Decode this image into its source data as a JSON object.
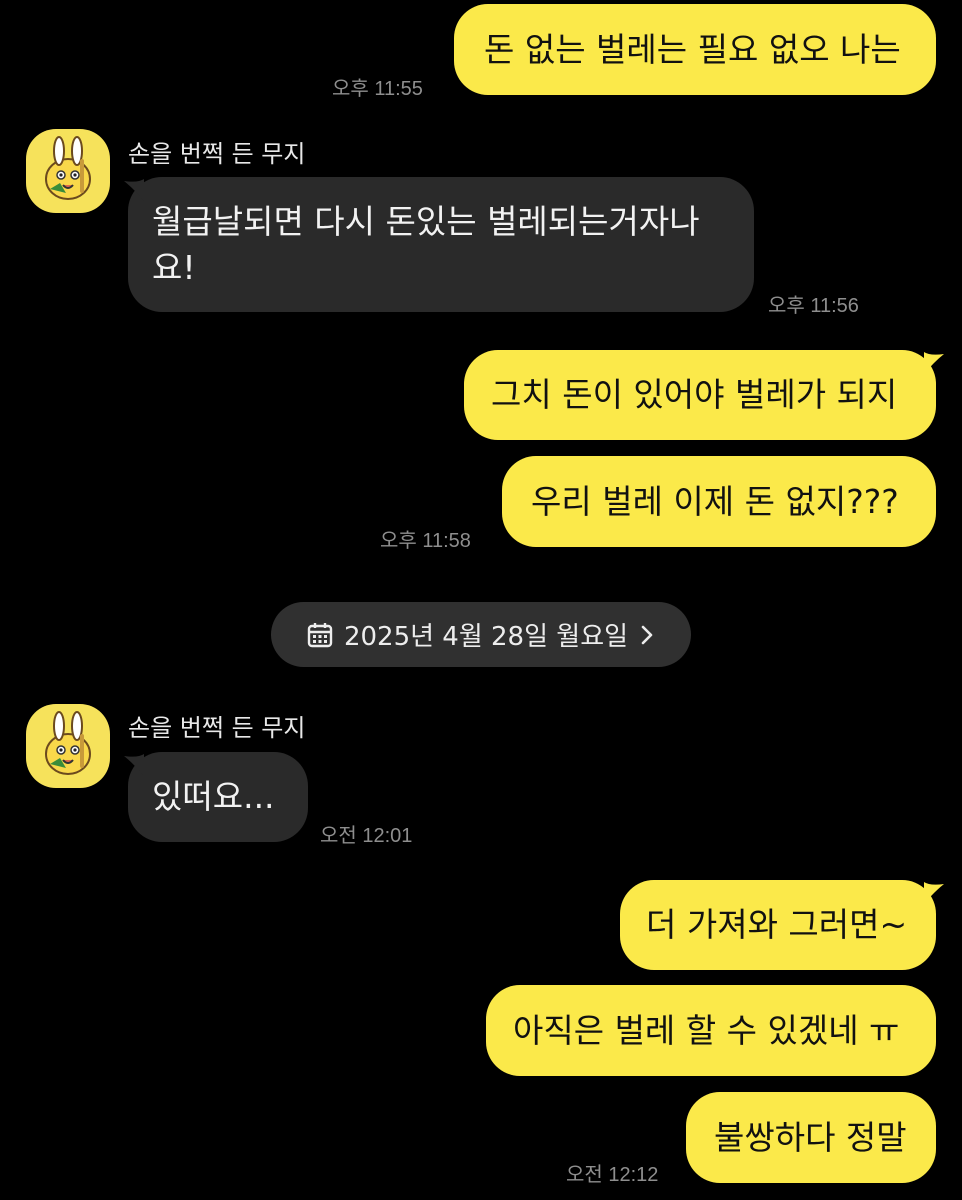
{
  "messages": [
    {
      "id": "m1",
      "side": "me",
      "text": "돈 없는 벌레는 필요 없오 나는",
      "time": "오후 11:55"
    },
    {
      "id": "m2",
      "side": "other",
      "sender": "손을 번쩍 든 무지",
      "lines": [
        "월급날되면 다시 돈있는 벌레되는거자나",
        "요!"
      ],
      "time": "오후 11:56"
    },
    {
      "id": "m3",
      "side": "me",
      "text": "그치 돈이 있어야 벌레가 되지"
    },
    {
      "id": "m4",
      "side": "me",
      "text": "우리 벌레 이제 돈 없지???",
      "time": "오후 11:58"
    },
    {
      "id": "m5",
      "side": "other",
      "sender": "손을 번쩍 든 무지",
      "text": "있떠요...",
      "time": "오전 12:01"
    },
    {
      "id": "m6",
      "side": "me",
      "text": "더 가져와 그러면~"
    },
    {
      "id": "m7",
      "side": "me",
      "text": "아직은 벌레 할 수 있겠네 ㅠ"
    },
    {
      "id": "m8",
      "side": "me",
      "text": "불쌍하다 정말",
      "time": "오전 12:12"
    }
  ],
  "date_divider": {
    "label": "2025년 4월 28일 월요일",
    "icon": "calendar-icon",
    "chevron": "chevron-right-icon"
  },
  "colors": {
    "me_bubble": "#FBE94A",
    "other_bubble": "#2A2A2A",
    "background": "#000000",
    "time_text": "#8E8E8E",
    "avatar_bg": "#F6E25B"
  }
}
